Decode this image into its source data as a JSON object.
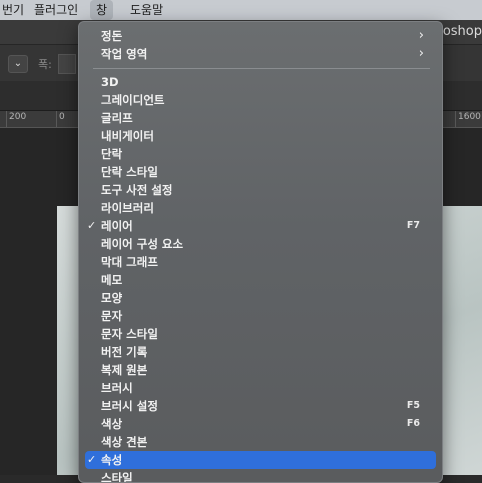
{
  "menubar": {
    "items": [
      "편집기",
      "플러그인",
      "창",
      "도움말"
    ],
    "partial_first": "번기",
    "active_index": 2
  },
  "app": {
    "title_partial": "otoshop"
  },
  "options_bar": {
    "width_label": "폭:",
    "dropdown_icon": "chevron-down-icon"
  },
  "ruler": {
    "ticks": [
      "200",
      "0",
      "1600"
    ]
  },
  "menu": {
    "top_items": [
      {
        "label": "정돈",
        "submenu": true
      },
      {
        "label": "작업 영역",
        "submenu": true
      }
    ],
    "items": [
      {
        "label": "3D"
      },
      {
        "label": "그레이디언트"
      },
      {
        "label": "글리프"
      },
      {
        "label": "내비게이터"
      },
      {
        "label": "단락"
      },
      {
        "label": "단락 스타일"
      },
      {
        "label": "도구 사전 설정"
      },
      {
        "label": "라이브러리"
      },
      {
        "label": "레이어",
        "checked": true,
        "shortcut": "F7"
      },
      {
        "label": "레이어 구성 요소"
      },
      {
        "label": "막대 그래프"
      },
      {
        "label": "메모"
      },
      {
        "label": "모양"
      },
      {
        "label": "문자"
      },
      {
        "label": "문자 스타일"
      },
      {
        "label": "버전 기록"
      },
      {
        "label": "복제 원본"
      },
      {
        "label": "브러시"
      },
      {
        "label": "브러시 설정",
        "shortcut": "F5"
      },
      {
        "label": "색상",
        "shortcut": "F6"
      },
      {
        "label": "색상 견본"
      },
      {
        "label": "속성",
        "checked": true,
        "highlighted": true
      },
      {
        "label": "스타일"
      }
    ],
    "check_glyph": "✓",
    "submenu_glyph": "›"
  }
}
